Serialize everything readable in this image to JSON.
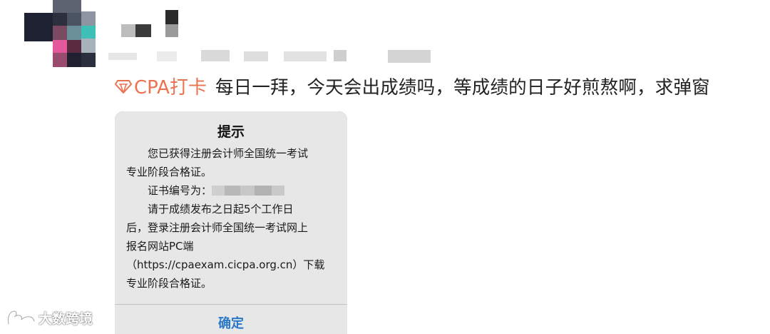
{
  "post": {
    "topic": {
      "label": "CPA打卡",
      "icon": "topic-diamond-icon",
      "color": "#eb7350"
    },
    "text": "每日一拜，今天会出成绩吗，等成绩的日子好煎熬啊，求弹窗"
  },
  "dialog": {
    "title": "提示",
    "lines": [
      "您已获得注册会计师全国统一考试",
      "专业阶段合格证。",
      "证书编号为：",
      "请于成绩发布之日起5个工作日",
      "后，登录注册会计师全国统一考试网上",
      "报名网站PC端",
      "（https://cpaexam.cicpa.org.cn）下载",
      "专业阶段合格证。"
    ],
    "confirm_label": "确定",
    "confirm_color": "#2b78c9"
  },
  "watermark": {
    "text": "大数跨境"
  }
}
